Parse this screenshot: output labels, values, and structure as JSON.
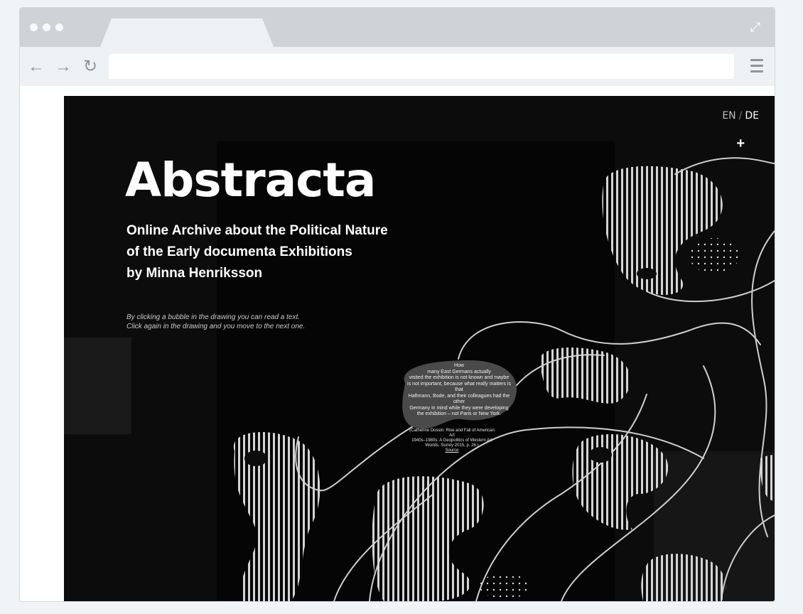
{
  "browser": {
    "tab_title": "",
    "url_value": "",
    "expand_icon": "expand-icon",
    "back_icon": "arrow-left-icon",
    "forward_icon": "arrow-right-icon",
    "reload_icon": "reload-icon",
    "menu_icon": "hamburger-menu-icon"
  },
  "page": {
    "lang": {
      "en": "EN",
      "separator": "/",
      "de": "DE"
    },
    "plus": "+",
    "title": "Abstracta",
    "subtitle": [
      "Online Archive about the Political Nature",
      "of the Early documenta Exhibitions",
      "by Minna Henriksson"
    ],
    "hint": [
      "By clicking a bubble in the drawing you can read a text.",
      "Click again in the drawing and you move to the next one."
    ],
    "bubble": {
      "lines": [
        "How",
        "many East Germans actually",
        "visited the exhibition is not known and maybe",
        "is not important, because what really matters is that",
        "Haftmann, Bode, and their colleagues had the other",
        "Germany in mind while they were developing",
        "the exhibition – not Paris or New York."
      ],
      "source_lines": [
        "(Catherine Dossin: Rise and Fall of American Art",
        "1940s–1980s: A Geopolitics of Western Art",
        "Worlds. Surrey 2015, p. 26.)"
      ],
      "source_link": "Source"
    }
  },
  "colors": {
    "page_bg": "#0c0c0c",
    "chalk": "#d9d9d9",
    "bubble": "#4a4a4a",
    "chrome": "#cfd3d6"
  }
}
